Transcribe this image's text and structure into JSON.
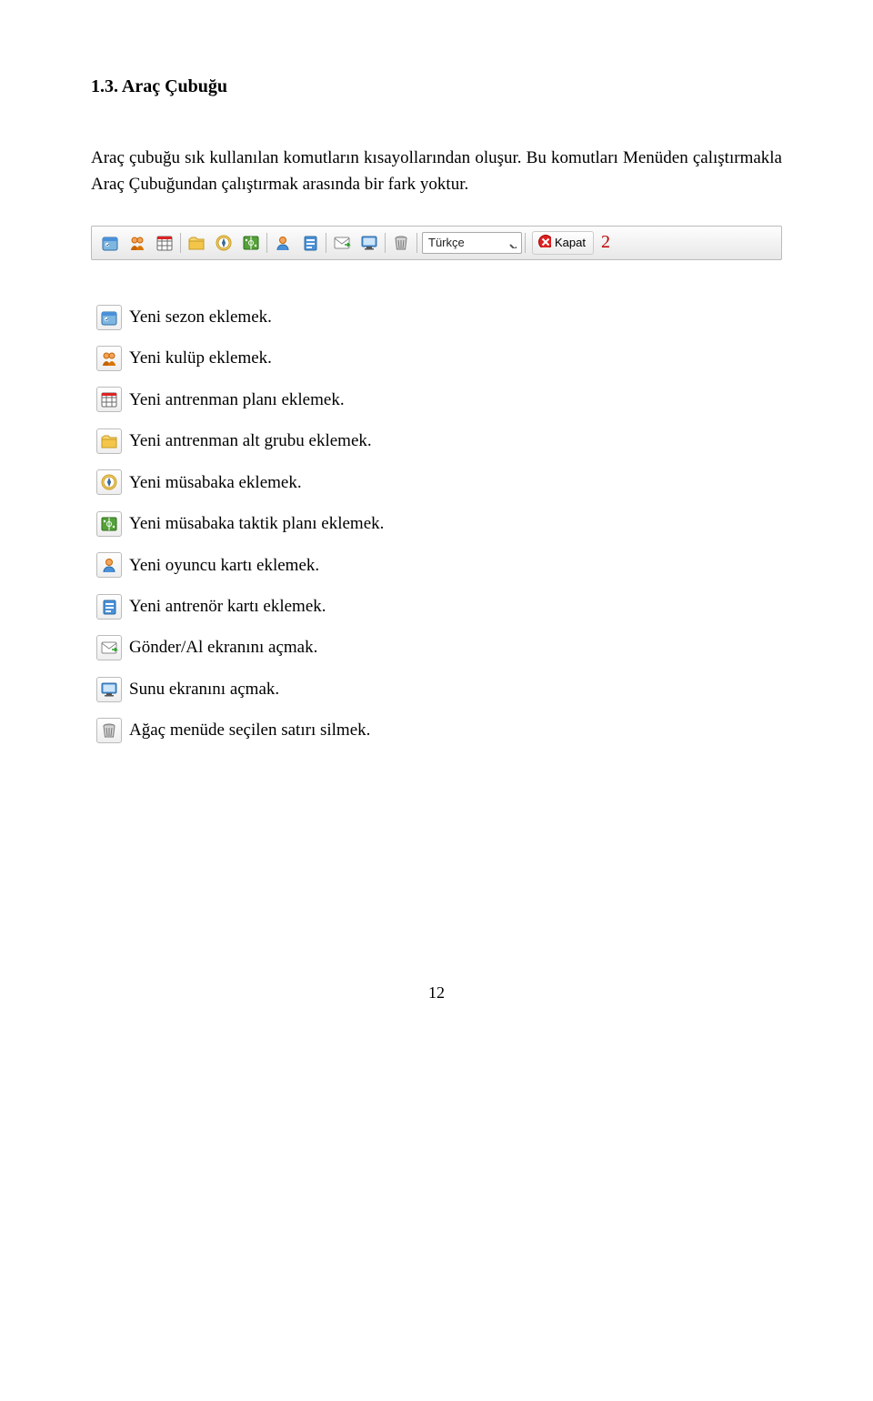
{
  "heading": "1.3. Araç Çubuğu",
  "intro": "Araç çubuğu sık kullanılan komutların kısayollarından oluşur. Bu komutları Menüden çalıştırmakla Araç Çubuğundan çalıştırmak arasında bir fark yoktur.",
  "toolbar": {
    "language_value": "Türkçe",
    "close_label": "Kapat",
    "callout": "2"
  },
  "items": [
    {
      "label": "Yeni sezon eklemek."
    },
    {
      "label": "Yeni kulüp eklemek."
    },
    {
      "label": "Yeni antrenman planı eklemek."
    },
    {
      "label": "Yeni antrenman alt grubu eklemek."
    },
    {
      "label": "Yeni müsabaka eklemek."
    },
    {
      "label": "Yeni müsabaka taktik planı eklemek."
    },
    {
      "label": "Yeni oyuncu kartı eklemek."
    },
    {
      "label": "Yeni antrenör kartı eklemek."
    },
    {
      "label": "Gönder/Al ekranını açmak."
    },
    {
      "label": "Sunu ekranını açmak."
    },
    {
      "label": "Ağaç menüde seçilen satırı silmek."
    }
  ],
  "page_number": "12"
}
